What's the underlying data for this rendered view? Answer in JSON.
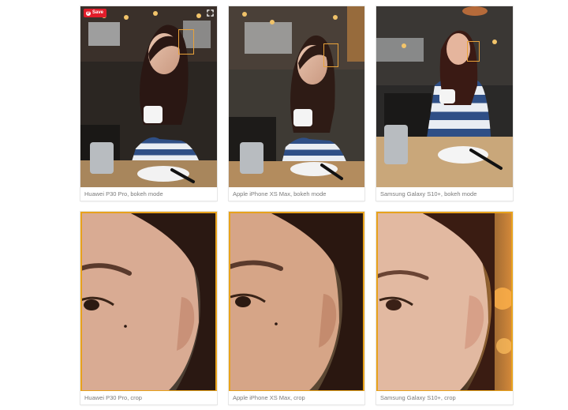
{
  "gallery": {
    "save_label": "Save",
    "items": [
      {
        "caption": "Huawei P30 Pro, bokeh mode"
      },
      {
        "caption": "Apple iPhone XS Max, bokeh mode"
      },
      {
        "caption": "Samsung Galaxy S10+, bokeh mode"
      },
      {
        "caption": "Huawei P30 Pro, crop"
      },
      {
        "caption": "Apple iPhone XS Max, crop"
      },
      {
        "caption": "Samsung Galaxy S10+, crop"
      }
    ]
  },
  "icons": {
    "save": "pinterest-icon",
    "expand": "expand-icon"
  },
  "colors": {
    "crop_frame": "#e8a21c",
    "save_button": "#e11d2a",
    "caption_text": "#7a7a7a"
  }
}
